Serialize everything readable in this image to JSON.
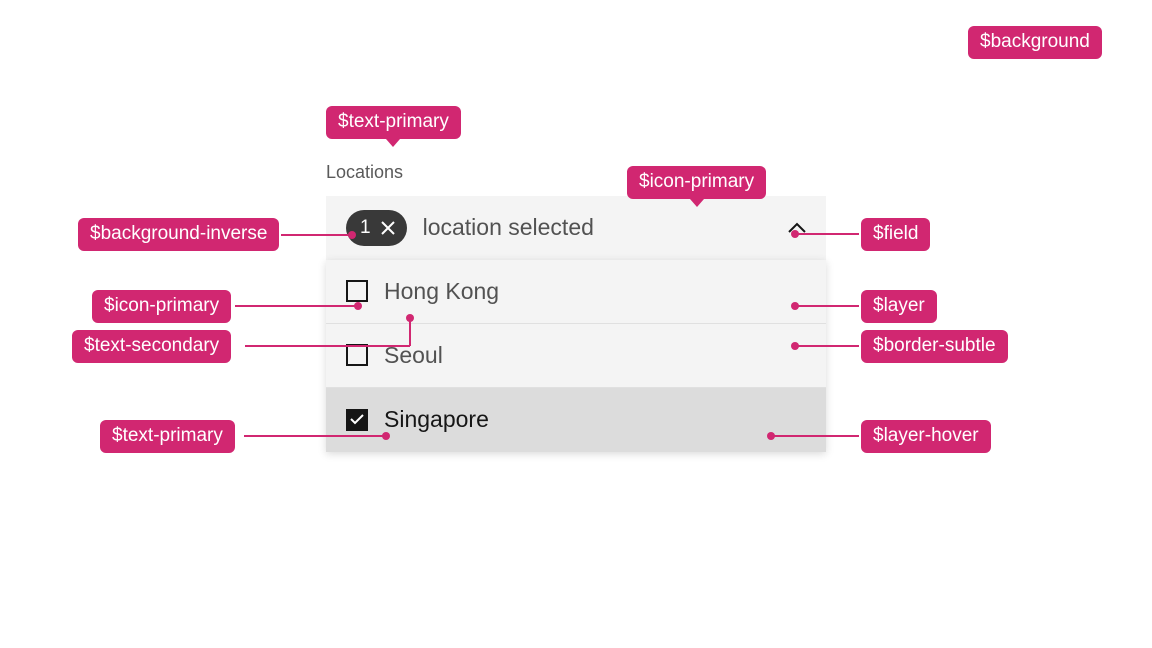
{
  "tokens": {
    "background": "$background",
    "text_primary": "$text-primary",
    "background_inverse": "$background-inverse",
    "icon_primary": "$icon-primary",
    "icon_primary_2": "$icon-primary",
    "text_secondary": "$text-secondary",
    "field": "$field",
    "layer": "$layer",
    "border_subtle": "$border-subtle",
    "layer_hover": "$layer-hover",
    "text_primary_2": "$text-primary"
  },
  "dropdown": {
    "label": "Locations",
    "selected_count": "1",
    "summary": "location selected",
    "options": [
      {
        "label": "Hong Kong",
        "checked": false,
        "hover": false
      },
      {
        "label": "Seoul",
        "checked": false,
        "hover": false
      },
      {
        "label": "Singapore",
        "checked": true,
        "hover": true
      }
    ]
  },
  "colors": {
    "annotation": "#d12771",
    "field_bg": "#f4f4f4",
    "layer_hover_bg": "#dcdcdc",
    "text_primary": "#161616",
    "text_secondary": "#525252",
    "border_subtle": "#e0e0e0",
    "background_inverse": "#393939"
  }
}
